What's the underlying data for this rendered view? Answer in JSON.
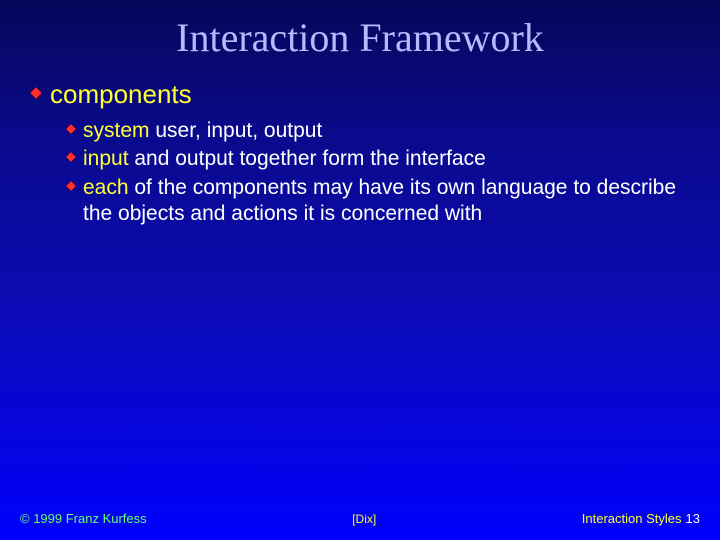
{
  "title": "Interaction Framework",
  "bullet_l1": {
    "lead": "components"
  },
  "sub": [
    {
      "lead": "system",
      "rest": " user, input, output"
    },
    {
      "lead": "input",
      "rest": " and output together form the interface"
    },
    {
      "lead": "each",
      "rest": " of the components may have its own language to describe the objects and actions it is concerned with"
    }
  ],
  "footer": {
    "copyright": "© 1999 Franz Kurfess",
    "citation": "[Dix]",
    "page_label": "Interaction Styles",
    "page_number": "13"
  },
  "colors": {
    "bullet_fill": "#ff3030",
    "bullet_stroke": "#6a0000"
  }
}
